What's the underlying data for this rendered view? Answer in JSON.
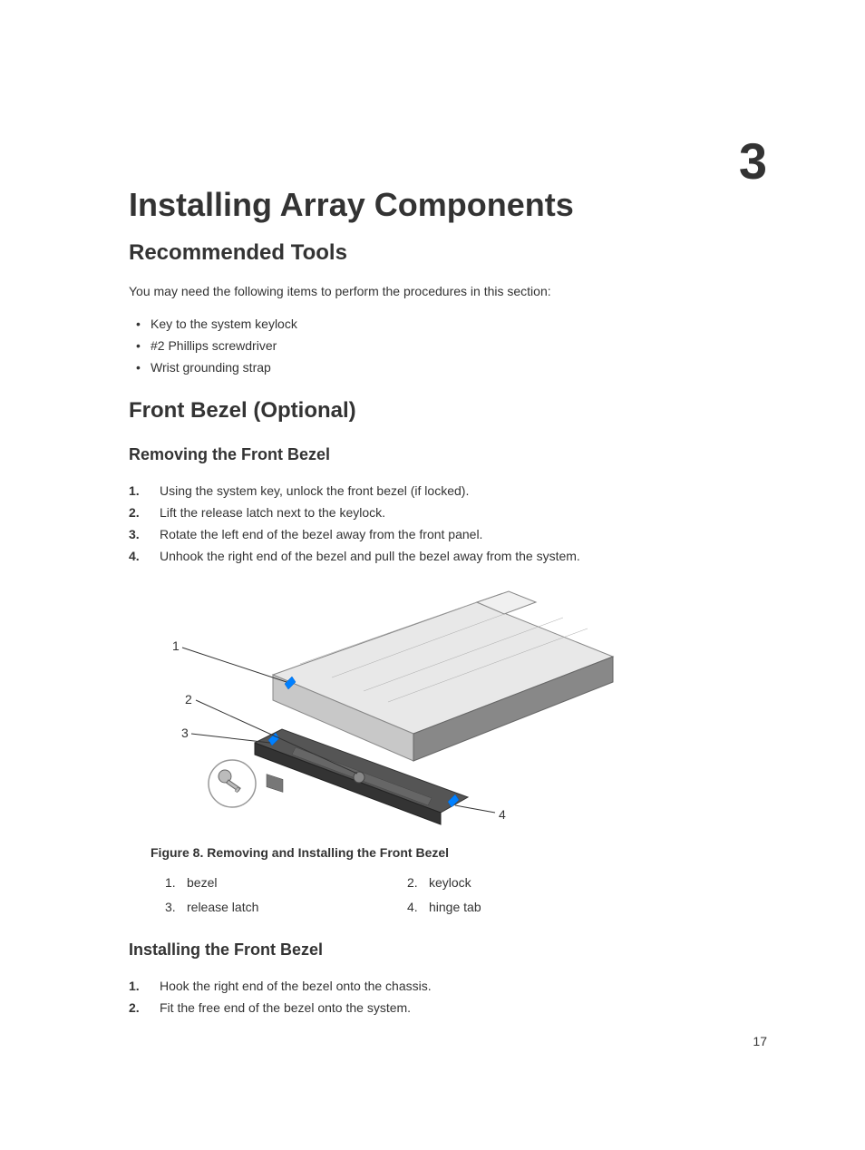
{
  "chapter": {
    "number": "3",
    "title": "Installing Array Components"
  },
  "sections": {
    "recommended_tools": {
      "title": "Recommended Tools",
      "intro": "You may need the following items to perform the procedures in this section:",
      "items": [
        "Key to the system keylock",
        "#2 Phillips screwdriver",
        "Wrist grounding strap"
      ]
    },
    "front_bezel": {
      "title": "Front Bezel (Optional)",
      "removing": {
        "title": "Removing the Front Bezel",
        "steps": [
          "Using the system key, unlock the front bezel (if locked).",
          "Lift the release latch next to the keylock.",
          "Rotate the left end of the bezel away from the front panel.",
          "Unhook the right end of the bezel and pull the bezel away from the system."
        ]
      },
      "figure": {
        "caption": "Figure 8. Removing and Installing the Front Bezel",
        "callouts": [
          {
            "num": "1.",
            "label": "bezel"
          },
          {
            "num": "2.",
            "label": "keylock"
          },
          {
            "num": "3.",
            "label": "release latch"
          },
          {
            "num": "4.",
            "label": "hinge tab"
          }
        ],
        "diagram_labels": [
          "1",
          "2",
          "3",
          "4"
        ]
      },
      "installing": {
        "title": "Installing the Front Bezel",
        "steps": [
          "Hook the right end of the bezel onto the chassis.",
          "Fit the free end of the bezel onto the system."
        ]
      }
    }
  },
  "page_number": "17"
}
